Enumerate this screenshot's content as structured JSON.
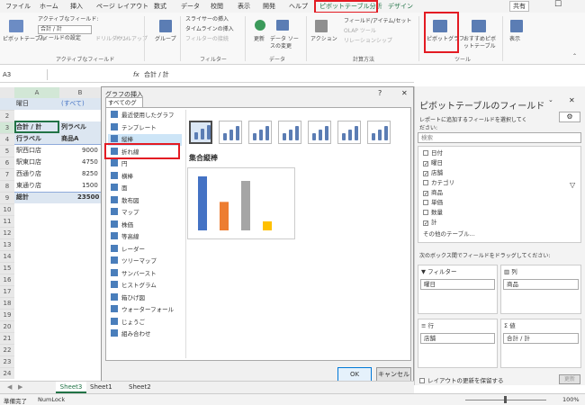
{
  "menu": {
    "file": "ファイル",
    "home": "ホーム",
    "insert": "挿入",
    "layout": "ページ レイアウト",
    "formulas": "数式",
    "data": "データ",
    "review": "校閲",
    "view": "表示",
    "developer": "開発",
    "help": "ヘルプ",
    "pivot_analyze": "ピボットテーブル分析",
    "design": "デザイン",
    "share": "共有"
  },
  "ribbon": {
    "pivot_btn": "ピボットテーブル",
    "active_field_label": "アクティブなフィールド:",
    "active_field_value": "合計 / 計",
    "field_settings": "フィールドの設定",
    "drill_down": "ドリルダウン",
    "drill_up": "ドリルアップ",
    "group": "グループ",
    "slicer": "スライサーの挿入",
    "timeline": "タイムラインの挿入",
    "filter_conn": "フィルターの接続",
    "refresh": "更新",
    "change_source": "データ ソースの変更",
    "action": "アクション",
    "fields_items": "フィールド/アイテム/セット",
    "olap": "OLAP ツール",
    "relations": "リレーションシップ",
    "pivot_chart": "ピボットグラフ",
    "recommended": "おすすめピボットテーブル",
    "show": "表示",
    "grp_active": "アクティブなフィールド",
    "grp_filter": "フィルター",
    "grp_data": "データ",
    "grp_calc": "計算方法",
    "grp_tool": "ツール"
  },
  "formula_bar": {
    "namebox": "A3",
    "fx": "fx",
    "content": "合計 / 計"
  },
  "sheet": {
    "cols": [
      "A",
      "B"
    ],
    "rows": [
      "1",
      "2",
      "3",
      "4",
      "5",
      "6",
      "7",
      "8",
      "9",
      "10",
      "11",
      "12",
      "13",
      "14",
      "15",
      "16",
      "17",
      "18",
      "19",
      "20",
      "21",
      "22",
      "23",
      "24"
    ],
    "r1a": "曜日",
    "r1b": "(すべて)",
    "r3a": "合計 / 計",
    "r3b": "列ラベル",
    "r4a": "行ラベル",
    "r4b": "商品A",
    "r5a": "駅西口店",
    "r5b": "9000",
    "r6a": "駅東口店",
    "r6b": "4750",
    "r7a": "西通り店",
    "r7b": "8250",
    "r8a": "東通り店",
    "r8b": "1500",
    "r9a": "総計",
    "r9b": "23500"
  },
  "dialog": {
    "title": "グラフの挿入",
    "help": "?",
    "close": "✕",
    "tab": "すべてのグラフ",
    "categories": [
      "最近使用したグラフ",
      "テンプレート",
      "縦棒",
      "折れ線",
      "円",
      "横棒",
      "面",
      "散布図",
      "マップ",
      "株価",
      "等高線",
      "レーダー",
      "ツリーマップ",
      "サンバースト",
      "ヒストグラム",
      "箱ひげ図",
      "ウォーターフォール",
      "じょうご",
      "組み合わせ"
    ],
    "subtype_title": "集合縦棒",
    "ok": "OK",
    "cancel": "キャンセル"
  },
  "pane": {
    "title": "ピボットテーブルのフィールド",
    "subtitle": "レポートに追加するフィールドを選択してください:",
    "search": "検索",
    "fields": [
      {
        "name": "日付",
        "checked": false
      },
      {
        "name": "曜日",
        "checked": true
      },
      {
        "name": "店舗",
        "checked": true
      },
      {
        "name": "カテゴリ",
        "checked": false
      },
      {
        "name": "商品",
        "checked": true
      },
      {
        "name": "単価",
        "checked": false
      },
      {
        "name": "数量",
        "checked": false
      },
      {
        "name": "計",
        "checked": true
      }
    ],
    "more": "その他のテーブル...",
    "drag_hint": "次のボックス間でフィールドをドラッグしてください:",
    "filter_label": "フィルター",
    "filter_val": "曜日",
    "col_label": "列",
    "col_val": "商品",
    "row_label": "行",
    "row_val": "店舗",
    "val_label": "値",
    "val_val": "合計 / 計",
    "defer": "レイアウトの更新を保留する",
    "update": "更新"
  },
  "tabs": {
    "sheet3": "Sheet3",
    "sheet1": "Sheet1",
    "sheet2": "Sheet2"
  },
  "status": {
    "ready": "準備完了",
    "numlock": "NumLock",
    "zoom": "100%"
  },
  "chart_data": {
    "type": "bar",
    "categories": [
      "駅西口店",
      "駅東口店",
      "西通り店",
      "東通り店"
    ],
    "title": "",
    "series": [
      {
        "values": [
          9000,
          4750,
          8250,
          1500
        ]
      }
    ]
  }
}
